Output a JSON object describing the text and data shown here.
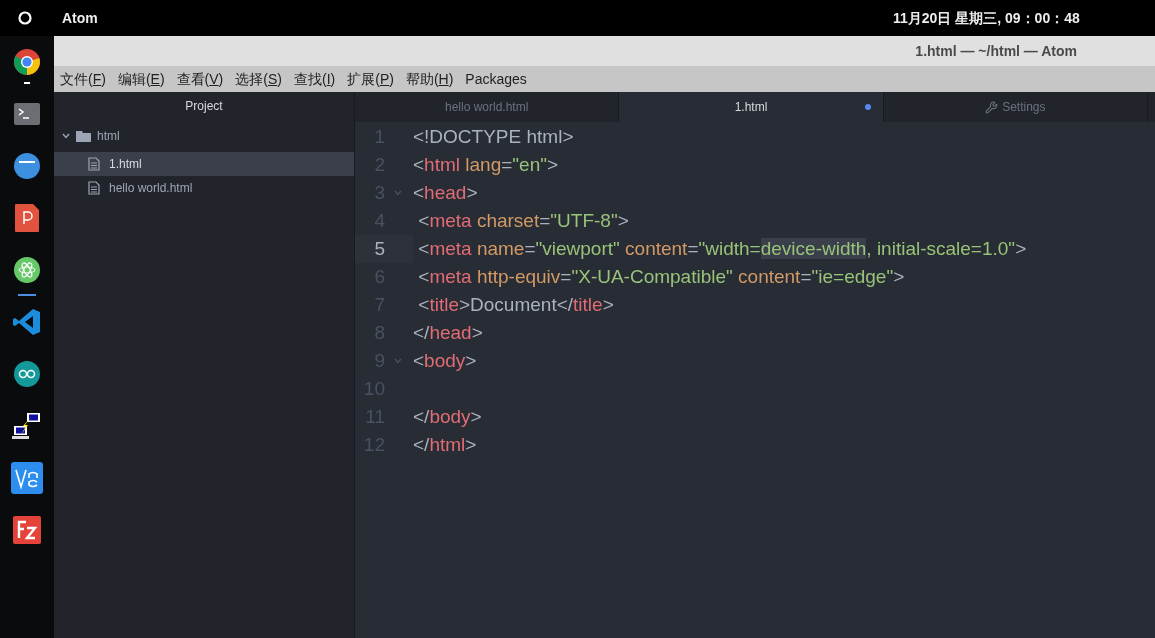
{
  "top_bar": {
    "app_name": "Atom",
    "clock": "11月20日 星期三, 09：00：48"
  },
  "dock": [
    {
      "kind": "browser",
      "running": true,
      "focused": false
    },
    {
      "kind": "terminal",
      "running": false,
      "focused": false
    },
    {
      "kind": "files",
      "running": false,
      "focused": false
    },
    {
      "kind": "pdf",
      "running": false,
      "focused": false
    },
    {
      "kind": "atom",
      "running": false,
      "focused": true
    },
    {
      "kind": "code",
      "running": false,
      "focused": false
    },
    {
      "kind": "arduino",
      "running": false,
      "focused": false
    },
    {
      "kind": "network",
      "running": false,
      "focused": false
    },
    {
      "kind": "vnc",
      "running": false,
      "focused": false
    },
    {
      "kind": "ftp",
      "running": false,
      "focused": false
    }
  ],
  "window": {
    "title": "1.html — ~/html — Atom"
  },
  "menu": [
    {
      "before": "文件(",
      "key": "F",
      "after": ")"
    },
    {
      "before": "编辑(",
      "key": "E",
      "after": ")"
    },
    {
      "before": "查看(",
      "key": "V",
      "after": ")"
    },
    {
      "before": "选择(",
      "key": "S",
      "after": ")"
    },
    {
      "before": "查找(",
      "key": "I",
      "after": ")"
    },
    {
      "before": "扩展(",
      "key": "P",
      "after": ")"
    },
    {
      "before": "帮助(",
      "key": "H",
      "after": ")"
    },
    {
      "before": "Packages"
    }
  ],
  "tree": {
    "title": "Project",
    "folder": {
      "name": "html",
      "expanded": true,
      "children": [
        {
          "name": "1.html",
          "selected": true
        },
        {
          "name": "hello world.html",
          "selected": false
        }
      ]
    }
  },
  "tabs": [
    {
      "kind": "file",
      "label": "hello world.html",
      "selected": false,
      "modified": false
    },
    {
      "kind": "file",
      "label": "1.html",
      "selected": true,
      "modified": true
    },
    {
      "kind": "settings",
      "label": "Settings",
      "selected": false,
      "modified": false
    }
  ],
  "lines": [
    {
      "number": "1",
      "foldable": false,
      "current": false,
      "tokens": [
        {
          "kind": "punct",
          "text": "<!DOCTYPE html>"
        }
      ]
    },
    {
      "number": "2",
      "foldable": false,
      "current": false,
      "tokens": [
        {
          "kind": "punct",
          "text": "<"
        },
        {
          "kind": "tag",
          "text": "html"
        },
        {
          "kind": "attr",
          "text": " lang"
        },
        {
          "kind": "punct",
          "text": "="
        },
        {
          "kind": "string",
          "text": "\"en\""
        },
        {
          "kind": "punct",
          "text": ">"
        }
      ]
    },
    {
      "number": "3",
      "foldable": true,
      "current": false,
      "tokens": [
        {
          "kind": "punct",
          "text": "<"
        },
        {
          "kind": "tag",
          "text": "head"
        },
        {
          "kind": "punct",
          "text": ">"
        }
      ]
    },
    {
      "number": "4",
      "foldable": false,
      "current": false,
      "tokens": [
        {
          "kind": "punct",
          "text": " <"
        },
        {
          "kind": "tag",
          "text": "meta"
        },
        {
          "kind": "attr",
          "text": " charset"
        },
        {
          "kind": "punct",
          "text": "="
        },
        {
          "kind": "string",
          "text": "\"UTF-8\""
        },
        {
          "kind": "punct",
          "text": ">"
        }
      ]
    },
    {
      "number": "5",
      "foldable": false,
      "current": true,
      "tokens": [
        {
          "kind": "punct",
          "text": " <"
        },
        {
          "kind": "tag",
          "text": "meta"
        },
        {
          "kind": "attr",
          "text": " name"
        },
        {
          "kind": "punct",
          "text": "="
        },
        {
          "kind": "string",
          "text": "\"viewport\""
        },
        {
          "kind": "attr",
          "text": " content"
        },
        {
          "kind": "punct",
          "text": "="
        },
        {
          "kind": "string",
          "text": "\"width="
        },
        {
          "kind": "string",
          "text": "device-width",
          "highlight": true
        },
        {
          "kind": "string",
          "text": ", initial-scale=1.0\""
        },
        {
          "kind": "punct",
          "text": ">"
        }
      ]
    },
    {
      "number": "6",
      "foldable": false,
      "current": false,
      "tokens": [
        {
          "kind": "punct",
          "text": " <"
        },
        {
          "kind": "tag",
          "text": "meta"
        },
        {
          "kind": "attr",
          "text": " http-equiv"
        },
        {
          "kind": "punct",
          "text": "="
        },
        {
          "kind": "string",
          "text": "\"X-UA-Compatible\""
        },
        {
          "kind": "attr",
          "text": " content"
        },
        {
          "kind": "punct",
          "text": "="
        },
        {
          "kind": "string",
          "text": "\"ie=edge\""
        },
        {
          "kind": "punct",
          "text": ">"
        }
      ]
    },
    {
      "number": "7",
      "foldable": false,
      "current": false,
      "tokens": [
        {
          "kind": "punct",
          "text": " <"
        },
        {
          "kind": "tag",
          "text": "title"
        },
        {
          "kind": "punct",
          "text": ">"
        },
        {
          "kind": "text",
          "text": "Document"
        },
        {
          "kind": "punct",
          "text": "</"
        },
        {
          "kind": "tag",
          "text": "title"
        },
        {
          "kind": "punct",
          "text": ">"
        }
      ]
    },
    {
      "number": "8",
      "foldable": false,
      "current": false,
      "tokens": [
        {
          "kind": "punct",
          "text": "</"
        },
        {
          "kind": "tag",
          "text": "head"
        },
        {
          "kind": "punct",
          "text": ">"
        }
      ]
    },
    {
      "number": "9",
      "foldable": true,
      "current": false,
      "tokens": [
        {
          "kind": "punct",
          "text": "<"
        },
        {
          "kind": "tag",
          "text": "body"
        },
        {
          "kind": "punct",
          "text": ">"
        }
      ]
    },
    {
      "number": "10",
      "foldable": false,
      "current": false
    },
    {
      "number": "11",
      "foldable": false,
      "current": false,
      "tokens": [
        {
          "kind": "punct",
          "text": "</"
        },
        {
          "kind": "tag",
          "text": "body"
        },
        {
          "kind": "punct",
          "text": ">"
        }
      ]
    },
    {
      "number": "12",
      "foldable": false,
      "current": false,
      "tokens": [
        {
          "kind": "punct",
          "text": "</"
        },
        {
          "kind": "tag",
          "text": "html"
        },
        {
          "kind": "punct",
          "text": ">"
        }
      ]
    }
  ]
}
